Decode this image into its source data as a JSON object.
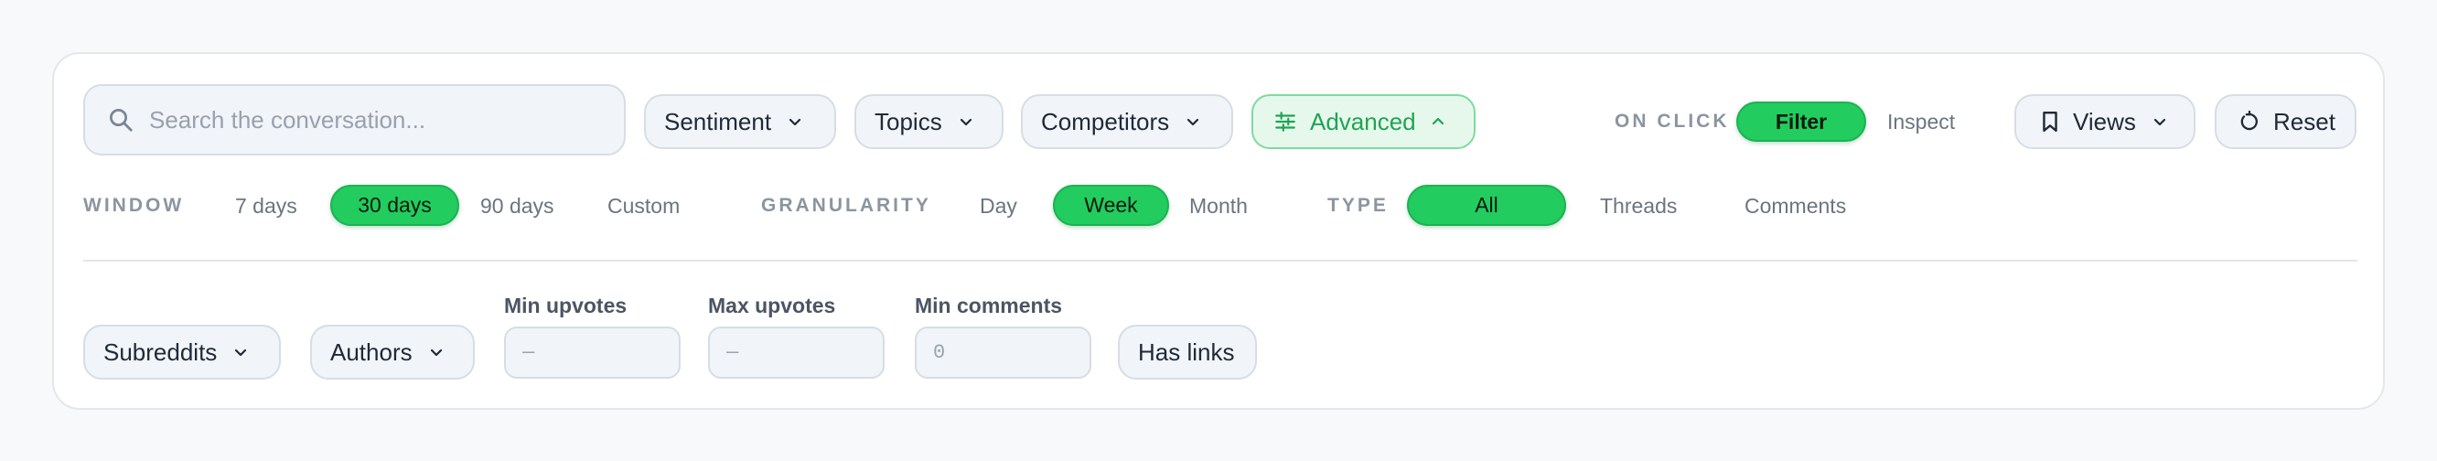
{
  "search": {
    "placeholder": "Search the conversation..."
  },
  "filters": {
    "sentiment": "Sentiment",
    "topics": "Topics",
    "competitors": "Competitors",
    "advanced": "Advanced"
  },
  "on_click": {
    "label": "ON CLICK",
    "options": [
      "Filter",
      "Inspect"
    ],
    "selected": "Filter"
  },
  "actions": {
    "views": "Views",
    "reset": "Reset"
  },
  "window": {
    "label": "WINDOW",
    "options": [
      "7 days",
      "30 days",
      "90 days",
      "Custom"
    ],
    "selected": "30 days"
  },
  "granularity": {
    "label": "GRANULARITY",
    "options": [
      "Day",
      "Week",
      "Month"
    ],
    "selected": "Week"
  },
  "type": {
    "label": "TYPE",
    "options": [
      "All",
      "Threads",
      "Comments"
    ],
    "selected": "All"
  },
  "advanced_panel": {
    "subreddits": "Subreddits",
    "authors": "Authors",
    "min_upvotes": {
      "label": "Min upvotes",
      "placeholder": "—"
    },
    "max_upvotes": {
      "label": "Max upvotes",
      "placeholder": "—"
    },
    "min_comments": {
      "label": "Min comments",
      "placeholder": "0"
    },
    "has_links": "Has links"
  },
  "colors": {
    "accent": "#22cc5e",
    "accent_border": "#1bb352",
    "advanced_bg": "#e6f8ec",
    "advanced_text": "#1ea453",
    "control_bg": "#f1f4f8",
    "control_border": "#d7dde5",
    "label_gray": "#8b95a1"
  },
  "icons": {
    "search": "search-icon",
    "chevron": "chevron-down-icon",
    "advanced": "sliders-icon",
    "advanced_chevron": "chevron-up-icon",
    "views": "bookmark-icon",
    "reset": "rotate-icon"
  }
}
